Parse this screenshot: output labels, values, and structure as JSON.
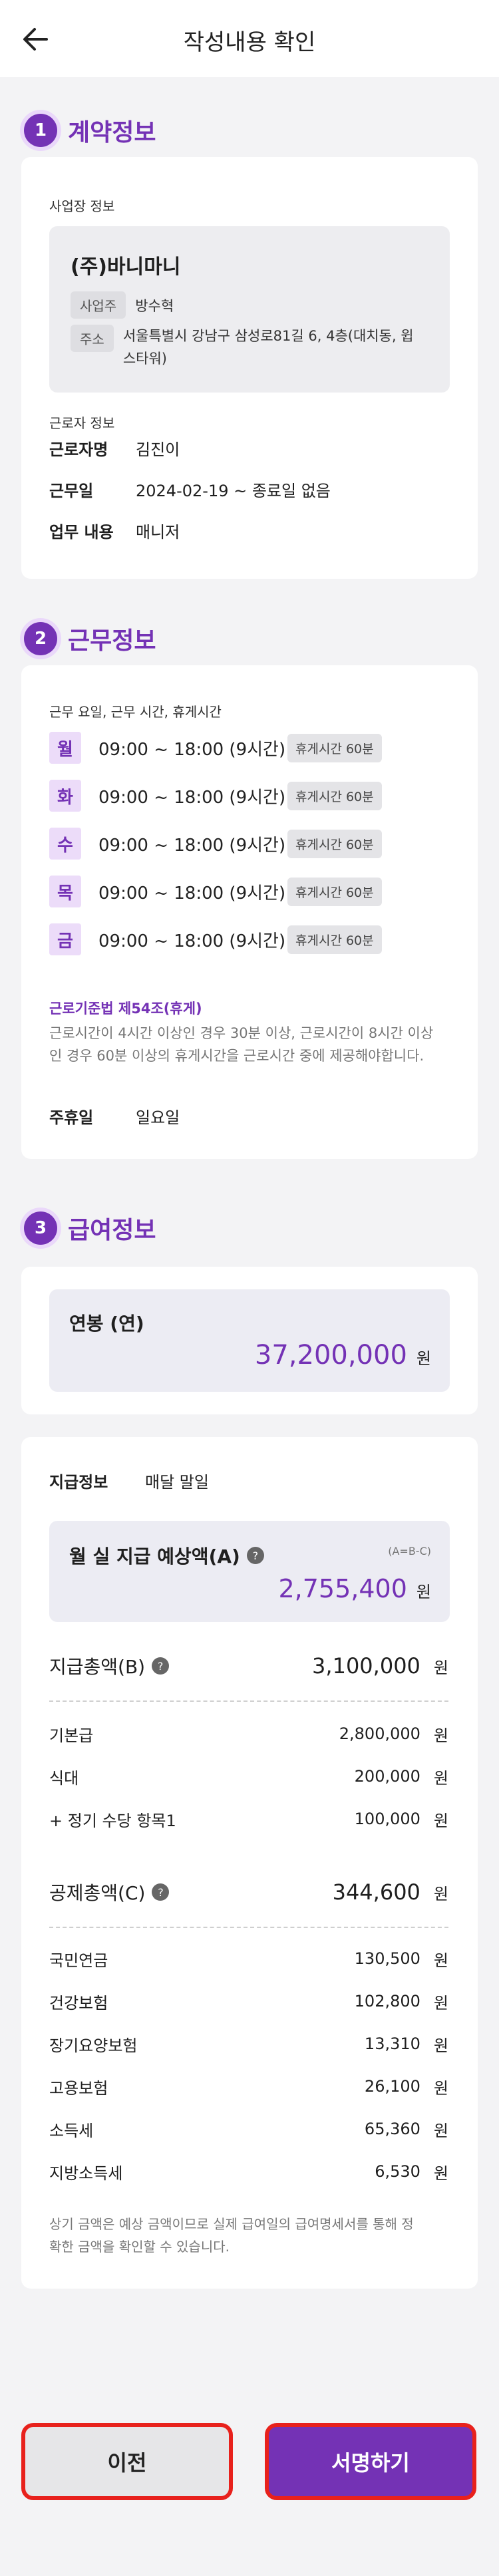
{
  "header": {
    "title": "작성내용 확인",
    "back_icon": "arrow-left-icon"
  },
  "colors": {
    "accent": "#7432b5",
    "highlight_border": "#e8211c"
  },
  "sections": {
    "contract": {
      "num": "1",
      "title": "계약정보"
    },
    "work": {
      "num": "2",
      "title": "근무정보"
    },
    "pay": {
      "num": "3",
      "title": "급여정보"
    }
  },
  "business": {
    "label": "사업장 정보",
    "name": "(주)바니마니",
    "owner_tag": "사업주",
    "owner": "방수혁",
    "addr_tag": "주소",
    "addr_line1": "서울특별시 강남구 삼성로81길 6, 4층(대치동, 윕",
    "addr_line2": "스타워)"
  },
  "worker": {
    "label": "근로자 정보",
    "name_key": "근로자명",
    "name": "김진이",
    "date_key": "근무일",
    "date": "2024-02-19 ~ 종료일 없음",
    "job_key": "업무 내용",
    "job": "매니저"
  },
  "schedule": {
    "label": "근무 요일, 근무 시간, 휴게시간",
    "days": [
      {
        "day": "월",
        "time": "09:00 ~ 18:00 (9시간)",
        "break": "휴게시간 60분"
      },
      {
        "day": "화",
        "time": "09:00 ~ 18:00 (9시간)",
        "break": "휴게시간 60분"
      },
      {
        "day": "수",
        "time": "09:00 ~ 18:00 (9시간)",
        "break": "휴게시간 60분"
      },
      {
        "day": "목",
        "time": "09:00 ~ 18:00 (9시간)",
        "break": "휴게시간 60분"
      },
      {
        "day": "금",
        "time": "09:00 ~ 18:00 (9시간)",
        "break": "휴게시간 60분"
      }
    ],
    "law_title": "근로기준법 제54조(휴게)",
    "law_line1": "근로시간이 4시간 이상인 경우 30분 이상, 근로시간이 8시간 이상",
    "law_line2": "인 경우 60분 이상의 휴게시간을 근로시간 중에 제공해야합니다.",
    "holiday_key": "주휴일",
    "holiday": "일요일"
  },
  "salary": {
    "annual_label": "연봉 (연)",
    "annual_value": "37,200,000",
    "unit": "원",
    "pay_info_key": "지급정보",
    "pay_info": "매달 말일",
    "net_label": "월 실 지급 예상액(A)",
    "net_formula": "(A=B-C)",
    "net_value": "2,755,400",
    "gross_label": "지급총액(B)",
    "gross_value": "3,100,000",
    "gross_items": [
      {
        "name": "기본급",
        "value": "2,800,000"
      },
      {
        "name": "식대",
        "value": "200,000"
      },
      {
        "name": "+ 정기 수당 항목1",
        "value": "100,000"
      }
    ],
    "deduct_label": "공제총액(C)",
    "deduct_value": "344,600",
    "deduct_items": [
      {
        "name": "국민연금",
        "value": "130,500"
      },
      {
        "name": "건강보험",
        "value": "102,800"
      },
      {
        "name": "장기요양보험",
        "value": "13,310"
      },
      {
        "name": "고용보험",
        "value": "26,100"
      },
      {
        "name": "소득세",
        "value": "65,360"
      },
      {
        "name": "지방소득세",
        "value": "6,530"
      }
    ],
    "notice_line1": "상기 금액은 예상 금액이므로 실제 급여일의 급여명세서를 통해 정",
    "notice_line2": "확한 금액을 확인할 수 있습니다."
  },
  "buttons": {
    "prev": "이전",
    "sign": "서명하기"
  }
}
